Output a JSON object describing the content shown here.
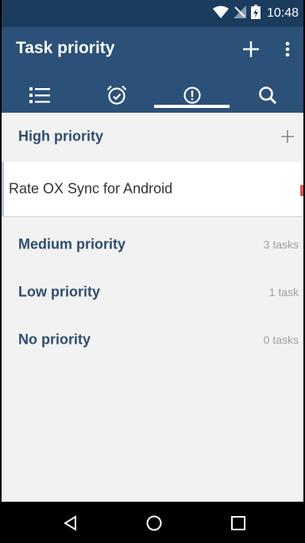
{
  "status_bar": {
    "time": "10:48"
  },
  "app_bar": {
    "title": "Task priority"
  },
  "tabs": [
    {
      "name": "list",
      "icon": "list-icon"
    },
    {
      "name": "reminders",
      "icon": "alarm-clock-icon"
    },
    {
      "name": "priority",
      "icon": "priority-icon",
      "selected": true
    },
    {
      "name": "search",
      "icon": "search-icon"
    }
  ],
  "sections": {
    "high": {
      "label": "High priority"
    },
    "medium": {
      "label": "Medium priority",
      "count": "3 tasks"
    },
    "low": {
      "label": "Low priority",
      "count": "1 task"
    },
    "none": {
      "label": "No priority",
      "count": "0 tasks"
    }
  },
  "tasks": [
    {
      "title": "Rate OX Sync for Android",
      "priority_color": "#e05050"
    }
  ],
  "colors": {
    "status_bar": "#1b3c5e",
    "app_bar": "#2b5178",
    "section_text": "#2e4d70",
    "background": "#f2f2f2"
  }
}
